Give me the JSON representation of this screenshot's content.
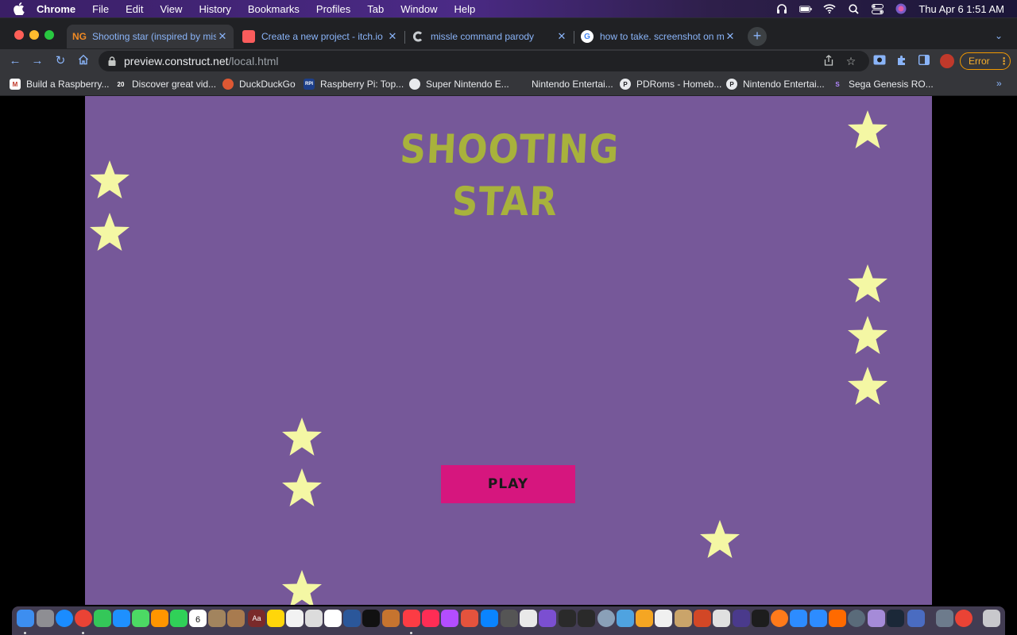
{
  "menubar": {
    "items": [
      "Chrome",
      "File",
      "Edit",
      "View",
      "History",
      "Bookmarks",
      "Profiles",
      "Tab",
      "Window",
      "Help"
    ],
    "clock": "Thu Apr 6  1:51 AM"
  },
  "tabs": [
    {
      "label": "Shooting star (inspired by missile",
      "favicon": "NG",
      "active": true
    },
    {
      "label": "Create a new project - itch.io",
      "favicon": "itch"
    },
    {
      "label": "missle command parody",
      "favicon": "construct"
    },
    {
      "label": "how to take. screenshot on mac",
      "favicon": "G"
    }
  ],
  "toolbar": {
    "url_host": "preview.construct.net",
    "url_path": "/local.html",
    "error_label": "Error"
  },
  "bookmarks": [
    {
      "label": "Build a Raspberry...",
      "favicon": "M"
    },
    {
      "label": "Discover great vid...",
      "favicon": "20"
    },
    {
      "label": "DuckDuckGo",
      "favicon": "D"
    },
    {
      "label": "Raspberry Pi: Top...",
      "favicon": "RPI"
    },
    {
      "label": "Super Nintendo E...",
      "favicon": "gh"
    },
    {
      "label": "Nintendo Entertai...",
      "favicon": ""
    },
    {
      "label": "PDRoms - Homeb...",
      "favicon": "P"
    },
    {
      "label": "Nintendo Entertai...",
      "favicon": "P"
    },
    {
      "label": "Sega Genesis RO...",
      "favicon": "S"
    }
  ],
  "game": {
    "title_line1": "SHOOTING",
    "title_line2": "STAR",
    "play_label": "PLAY",
    "star_color": "#f4f7a4",
    "background": "#765899",
    "button_color": "#d6167e",
    "title_color": "#a8b23c"
  },
  "dock": {
    "calendar_day": "6",
    "dictionary_label": "Aa"
  }
}
